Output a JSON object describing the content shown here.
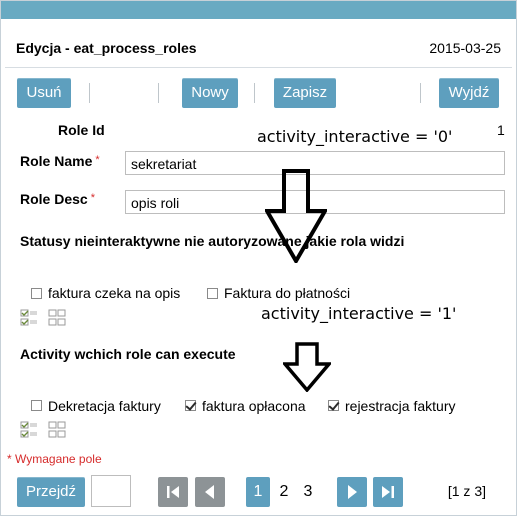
{
  "header": {
    "title": "Edycja - eat_process_roles",
    "date": "2015-03-25"
  },
  "toolbar": {
    "delete_label": "Usuń",
    "new_label": "Nowy",
    "save_label": "Zapisz",
    "exit_label": "Wyjdź"
  },
  "form": {
    "role_id_label": "Role Id",
    "role_id_value": "1",
    "role_name_label": "Role Name",
    "role_name_value": "sekretariat",
    "role_desc_label": "Role Desc",
    "role_desc_value": "opis roli",
    "required_mark": "*"
  },
  "annotations": {
    "top": "activity_interactive = '0'",
    "bottom": "activity_interactive = '1'"
  },
  "section1": {
    "title": "Statusy nieinteraktywne nie autoryzowane jakie rola widzi",
    "items": [
      {
        "label": "faktura czeka na opis",
        "checked": false
      },
      {
        "label": "Faktura do płatności",
        "checked": false
      }
    ]
  },
  "section2": {
    "title": "Activity wchich role can execute",
    "items": [
      {
        "label": "Dekretacja faktury",
        "checked": false
      },
      {
        "label": "faktura opłacona",
        "checked": true
      },
      {
        "label": "rejestracja faktury",
        "checked": true
      }
    ]
  },
  "footer": {
    "required_note": "* Wymagane pole",
    "goto_label": "Przejdź",
    "goto_value": "",
    "pages": [
      "1",
      "2",
      "3"
    ],
    "current_page": "1",
    "page_info": "[1 z 3]"
  },
  "icons": {
    "select_all": "check-all-icon",
    "deselect_all": "uncheck-all-icon",
    "first": "first-page-icon",
    "prev": "prev-page-icon",
    "next": "next-page-icon",
    "last": "last-page-icon",
    "arrow": "down-arrow-icon"
  },
  "colors": {
    "accent": "#5e9fbe",
    "topbar": "#69aac2",
    "required": "#d62b2b",
    "pager_gray": "#8d9396"
  }
}
